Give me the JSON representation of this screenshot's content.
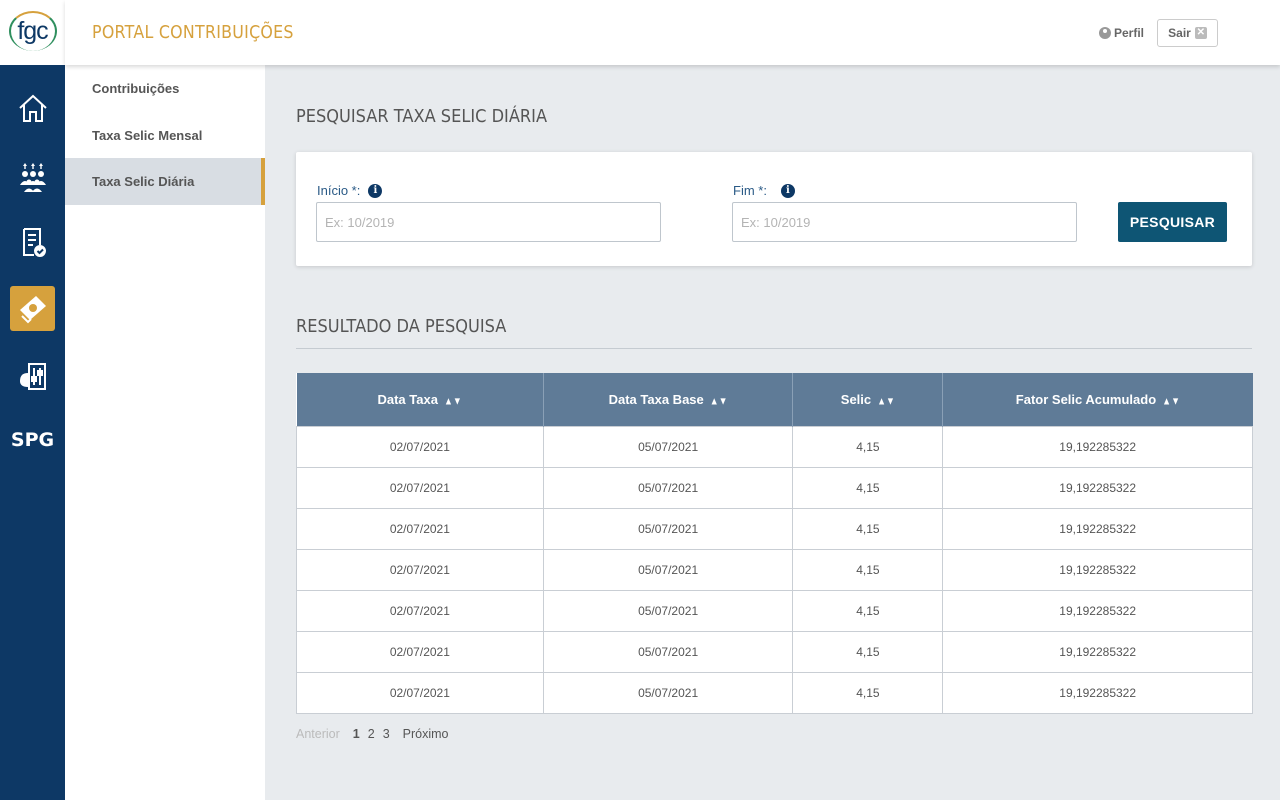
{
  "app": {
    "logo": "fgc",
    "title": "PORTAL CONTRIBUIÇÕES",
    "perfil_label": "Perfil",
    "sair_label": "Sair"
  },
  "rail": {
    "items": [
      {
        "icon": "home-icon"
      },
      {
        "icon": "people-icon"
      },
      {
        "icon": "document-check-icon"
      },
      {
        "icon": "money-icon"
      },
      {
        "icon": "settings-sliders-icon"
      },
      {
        "label": "SPG"
      }
    ],
    "active_color": "#d6a13d",
    "background": "#0d3865"
  },
  "subnav": {
    "items": [
      {
        "label": "Contribuições"
      },
      {
        "label": "Taxa Selic Mensal"
      },
      {
        "label": "Taxa Selic Diária"
      }
    ],
    "active_index": 2
  },
  "page": {
    "title": "PESQUISAR TAXA SELIC DIÁRIA",
    "inicio_label": "Início *:",
    "inicio_placeholder": "Ex: 10/2019",
    "fim_label": "Fim *:",
    "fim_placeholder": "Ex: 10/2019",
    "search_button": "PESQUISAR",
    "results_title": "RESULTADO DA PESQUISA"
  },
  "table": {
    "columns": [
      "Data Taxa",
      "Data Taxa Base",
      "Selic",
      "Fator Selic Acumulado"
    ],
    "rows": [
      [
        "02/07/2021",
        "05/07/2021",
        "4,15",
        "19,192285322"
      ],
      [
        "02/07/2021",
        "05/07/2021",
        "4,15",
        "19,192285322"
      ],
      [
        "02/07/2021",
        "05/07/2021",
        "4,15",
        "19,192285322"
      ],
      [
        "02/07/2021",
        "05/07/2021",
        "4,15",
        "19,192285322"
      ],
      [
        "02/07/2021",
        "05/07/2021",
        "4,15",
        "19,192285322"
      ],
      [
        "02/07/2021",
        "05/07/2021",
        "4,15",
        "19,192285322"
      ],
      [
        "02/07/2021",
        "05/07/2021",
        "4,15",
        "19,192285322"
      ]
    ]
  },
  "pagination": {
    "prev": "Anterior",
    "pages": [
      "1",
      "2",
      "3"
    ],
    "current": "1",
    "next": "Próximo"
  }
}
